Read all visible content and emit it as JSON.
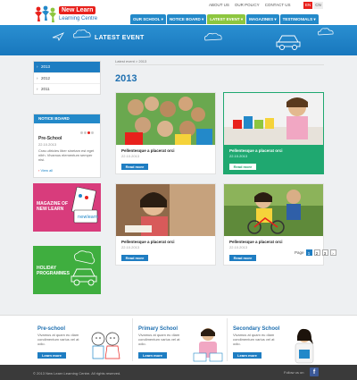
{
  "brand": {
    "name_top": "New Learn",
    "name_bottom": "Learning Centre"
  },
  "top_links": [
    "ABOUT US",
    "OUR POLICY",
    "CONTACT US"
  ],
  "languages": [
    "EN",
    "CN"
  ],
  "nav": [
    "OUR SCHOOL",
    "NOTICE BOARD",
    "LATEST EVENT",
    "MAGAZINES",
    "TESTIMONIALS"
  ],
  "banner": {
    "title": "LATEST EVENT"
  },
  "years": [
    "2013",
    "2012",
    "2011"
  ],
  "notice_board": {
    "header": "NOTICE BOARD",
    "category": "Pre-School",
    "date": "22.10.2013",
    "text": "Cras ultricies liber sinetam est eget nibh. Vivamus elementum semper nisi.",
    "view_all": "View all"
  },
  "promos": {
    "magazine": "MAGAZINE OF NEW LEARN",
    "holiday": "HOLIDAY PROGRAMMES"
  },
  "breadcrumb": "Latest event > 2013",
  "page_title": "2013",
  "cards": [
    {
      "title": "Pellentesque a placerat orci",
      "date": "22.10.2013",
      "button": "Read more"
    },
    {
      "title": "Pellentesque a placerat orci",
      "date": "22.10.2013",
      "button": "Read more"
    },
    {
      "title": "Pellentesque a placerat orci",
      "date": "22.10.2013",
      "button": "Read more"
    },
    {
      "title": "Pellentesque a placerat orci",
      "date": "22.10.2013",
      "button": "Read more"
    }
  ],
  "pagination": {
    "label": "Page",
    "pages": [
      "1",
      "2",
      "3"
    ],
    "next": "›"
  },
  "schools": [
    {
      "title": "Pre-school",
      "desc": "Vivamus at quam eu diam condimentum varius vel at odio.",
      "button": "Learn more"
    },
    {
      "title": "Primary School",
      "desc": "Vivamus at quam eu diam condimentum varius vel at odio.",
      "button": "Learn more"
    },
    {
      "title": "Secondary School",
      "desc": "Vivamus at quam eu diam condimentum varius vel at odio.",
      "button": "Learn more"
    }
  ],
  "footer": {
    "copyright": "© 2013 New Learn Learning Centre. All rights reserved.",
    "follow": "Follow us on"
  },
  "colors": {
    "blue": "#1e7dc2",
    "green": "#8dc63f",
    "card_green": "#1fa870",
    "red": "#e8211c",
    "pink": "#d83c7c",
    "lime": "#3fae3f"
  }
}
